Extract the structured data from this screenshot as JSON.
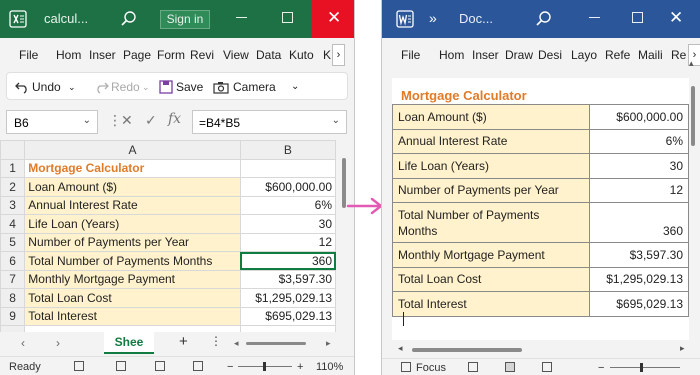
{
  "excel": {
    "title": "calcul...",
    "signin_label": "Sign in",
    "close_glyph": "✕",
    "menu": [
      "File",
      "Hom",
      "Inser",
      "Page",
      "Form",
      "Revi",
      "View",
      "Data",
      "Kuto",
      "K"
    ],
    "menu_more": "›",
    "toolbar": {
      "undo": "Undo",
      "redo": "Redo",
      "save": "Save",
      "camera": "Camera"
    },
    "name_box": "B6",
    "formula": "=B4*B5",
    "col_a": "A",
    "col_b": "B",
    "rows": [
      {
        "n": "1",
        "label": "Mortgage Calculator",
        "value": ""
      },
      {
        "n": "2",
        "label": "Loan Amount ($)",
        "value": "$600,000.00"
      },
      {
        "n": "3",
        "label": "Annual Interest Rate",
        "value": "6%"
      },
      {
        "n": "4",
        "label": "Life Loan (Years)",
        "value": "30"
      },
      {
        "n": "5",
        "label": "Number of Payments per Year",
        "value": "12"
      },
      {
        "n": "6",
        "label": "Total Number of Payments Months",
        "value": "360"
      },
      {
        "n": "7",
        "label": "Monthly Mortgage Payment",
        "value": "$3,597.30"
      },
      {
        "n": "8",
        "label": "Total Loan Cost",
        "value": "$1,295,029.13"
      },
      {
        "n": "9",
        "label": "Total Interest",
        "value": "$695,029.13"
      }
    ],
    "sheet_tab": "Shee",
    "add_sheet": "+",
    "status": "Ready",
    "zoom": "110%",
    "zoom_minus": "−",
    "zoom_plus": "+"
  },
  "word": {
    "title": "Doc...",
    "chevrons": "»",
    "close_glyph": "✕",
    "menu": [
      "File",
      "Hom",
      "Inser",
      "Draw",
      "Desi",
      "Layo",
      "Refe",
      "Maili",
      "Re"
    ],
    "menu_more": "›",
    "doc_title": "Mortgage Calculator",
    "rows": [
      {
        "label": "Loan Amount ($)",
        "value": "$600,000.00"
      },
      {
        "label": "Annual Interest Rate",
        "value": "6%"
      },
      {
        "label": "Life Loan (Years)",
        "value": "30"
      },
      {
        "label": "Number of Payments per Year",
        "value": "12"
      },
      {
        "label": "Total Number of Payments Months",
        "value": "360"
      },
      {
        "label": "Monthly Mortgage Payment",
        "value": "$3,597.30"
      },
      {
        "label": "Total Loan Cost",
        "value": "$1,295,029.13"
      },
      {
        "label": "Total Interest",
        "value": "$695,029.13"
      }
    ],
    "status_focus": "Focus"
  },
  "colors": {
    "excel_green": "#1e7145",
    "word_blue": "#2b579a",
    "label_fill": "#fff2cc",
    "title_orange": "#e07b28",
    "arrow_pink": "#e35ab5"
  }
}
